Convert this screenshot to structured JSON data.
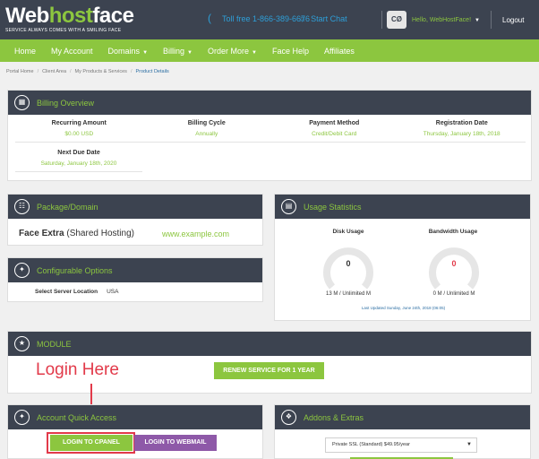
{
  "header": {
    "logo_web": "Web",
    "logo_host": "host",
    "logo_face": "face",
    "tagline": "SERVICE ALWAYS COMES WITH A SMILING FACE",
    "tollfree": "Toll free 1-866-389-6676",
    "start_chat": "Start Chat",
    "avatar_initials": "CØ",
    "hello": "Hello, WebHostFace!",
    "logout": "Logout"
  },
  "nav": {
    "items": [
      {
        "label": "Home"
      },
      {
        "label": "My Account"
      },
      {
        "label": "Domains",
        "dropdown": true
      },
      {
        "label": "Billing",
        "dropdown": true
      },
      {
        "label": "Order More",
        "dropdown": true
      },
      {
        "label": "Face Help"
      },
      {
        "label": "Affiliates"
      }
    ]
  },
  "breadcrumb": [
    "Portal Home",
    "Client Area",
    "My Products & Services",
    "Product Details"
  ],
  "billing": {
    "title": "Billing Overview",
    "recurring_label": "Recurring Amount",
    "recurring_value": "$0.00 USD",
    "cycle_label": "Billing Cycle",
    "cycle_value": "Annually",
    "payment_label": "Payment Method",
    "payment_value": "Credit/Debit Card",
    "reg_label": "Registration Date",
    "reg_value": "Thursday, January 18th, 2018",
    "next_label": "Next Due Date",
    "next_value": "Saturday, January 18th, 2020"
  },
  "package": {
    "title": "Package/Domain",
    "plan_bold": "Face Extra",
    "plan_rest": " (Shared Hosting)",
    "domain": "www.example.com"
  },
  "config": {
    "title": "Configurable Options",
    "label": "Select Server Location",
    "value": "USA"
  },
  "usage": {
    "title": "Usage Statistics",
    "disk_label": "Disk Usage",
    "disk_value": "0",
    "disk_detail": "13 M / Unlimited M",
    "bw_label": "Bandwidth Usage",
    "bw_value": "0",
    "bw_detail": "0 M / Unlimited M",
    "updated": "Last Updated Sunday, June 24th, 2018 (06:05)"
  },
  "module": {
    "title": "MODULE",
    "renew_label": "RENEW SERVICE FOR 1 YEAR"
  },
  "annotation": {
    "login_here": "Login Here"
  },
  "quick": {
    "title": "Account Quick Access",
    "cpanel_label": "LOGIN TO CPANEL",
    "webmail_label": "LOGIN TO WEBMAIL"
  },
  "addons": {
    "title": "Addons & Extras",
    "selected": "Private SSL (Standard) $49.95/year"
  },
  "colors": {
    "dark": "#3c4350",
    "green": "#8cc63f",
    "blue": "#2e9fd8",
    "purple": "#8e59a8",
    "red": "#e23a4a"
  }
}
